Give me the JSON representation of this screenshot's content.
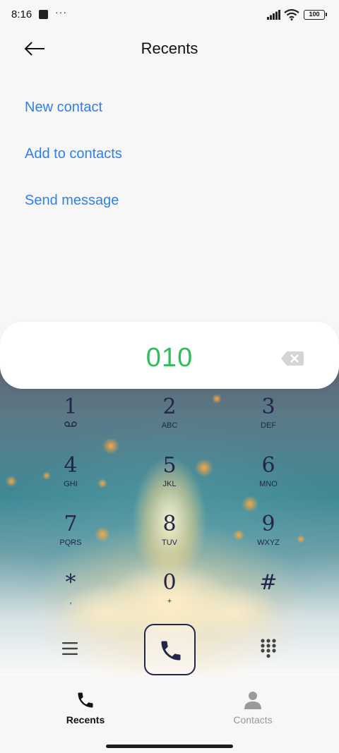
{
  "status_bar": {
    "time": "8:16",
    "more": "···",
    "battery": "100"
  },
  "header": {
    "title": "Recents",
    "back_icon": "arrow-left-icon"
  },
  "actions": {
    "new_contact": "New contact",
    "add_to_contacts": "Add to contacts",
    "send_message": "Send message"
  },
  "dialer": {
    "number": "010",
    "backspace_icon": "backspace-icon",
    "keys": [
      {
        "digit": "1",
        "letters": ""
      },
      {
        "digit": "2",
        "letters": "ABC"
      },
      {
        "digit": "3",
        "letters": "DEF"
      },
      {
        "digit": "4",
        "letters": "GHI"
      },
      {
        "digit": "5",
        "letters": "JKL"
      },
      {
        "digit": "6",
        "letters": "MNO"
      },
      {
        "digit": "7",
        "letters": "PQRS"
      },
      {
        "digit": "8",
        "letters": "TUV"
      },
      {
        "digit": "9",
        "letters": "WXYZ"
      },
      {
        "digit": "*",
        "letters": ","
      },
      {
        "digit": "0",
        "letters": "+"
      },
      {
        "digit": "#",
        "letters": ""
      }
    ]
  },
  "bottom_nav": {
    "recents": "Recents",
    "contacts": "Contacts"
  },
  "colors": {
    "accent": "#2f80ed",
    "number": "#2fbf5a",
    "keypad_text": "#23264a"
  }
}
